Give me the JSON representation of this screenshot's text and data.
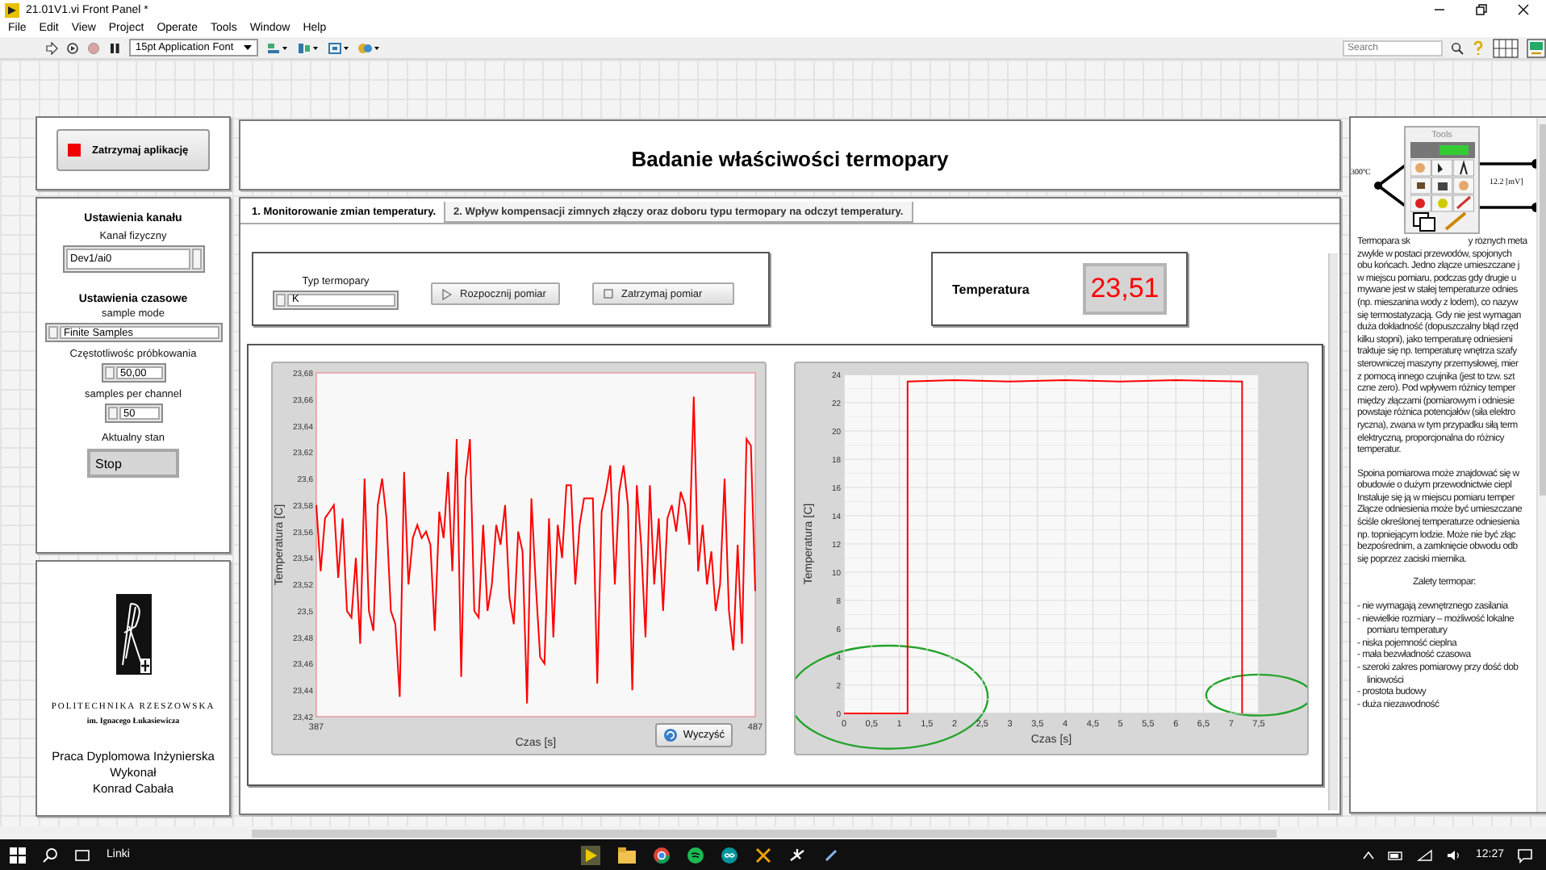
{
  "window": {
    "title": "21.01V1.vi Front Panel *"
  },
  "menu": [
    "File",
    "Edit",
    "View",
    "Project",
    "Operate",
    "Tools",
    "Window",
    "Help"
  ],
  "toolbar": {
    "font": "15pt Application Font",
    "search": {
      "placeholder": "Search"
    }
  },
  "stop_app_button": {
    "label": "Zatrzymaj aplikację"
  },
  "channel_settings": {
    "title": "Ustawienia kanału",
    "physical_channel": {
      "label": "Kanał fizyczny",
      "value": "Dev1/ai0"
    }
  },
  "timing_settings": {
    "title": "Ustawienia czasowe",
    "sample_mode": {
      "label": "sample mode",
      "value": "Finite Samples"
    },
    "sampling_rate": {
      "label": "Częstotliwośc próbkowania",
      "value": "50,00"
    },
    "samples_per_channel": {
      "label": "samples per channel",
      "value": "50"
    },
    "status": {
      "label": "Aktualny stan",
      "value": "Stop"
    }
  },
  "credits": {
    "university": "POLITECHNIKA RZESZOWSKA",
    "patron": "im. Ignacego Łukasiewicza",
    "lines": [
      "Praca Dyplomowa Inżynierska",
      "Wykonał",
      "Konrad Cabała"
    ]
  },
  "header": {
    "title": "Badanie właściwości termopary"
  },
  "tabs": [
    {
      "label": "1. Monitorowanie zmian temperatury.",
      "selected": true
    },
    {
      "label": "2. Wpływ kompensacji zimnych złączy oraz doboru typu termopary na odczyt temperatury.",
      "selected": false
    }
  ],
  "measurement": {
    "thermocouple_type": {
      "label": "Typ termopary",
      "value": "K"
    },
    "buttons": [
      {
        "label": "Rozpocznij pomiar",
        "kind": "play"
      },
      {
        "label": "Zatrzymaj pomiar",
        "kind": "stop"
      }
    ]
  },
  "temperature": {
    "label": "Temperatura",
    "value": "23,51"
  },
  "charts": [
    {
      "clear_button": "Wyczyść",
      "chart_data": {
        "type": "line",
        "xlabel": "Czas [s]",
        "ylabel": "Temperatura [C]",
        "xlim": [
          387,
          487
        ],
        "ylim": [
          23.42,
          23.68
        ],
        "grid": false,
        "x": [
          387,
          388,
          389,
          390,
          391,
          392,
          393,
          394,
          395,
          396,
          397,
          398,
          399,
          400,
          401,
          402,
          403,
          404,
          405,
          406,
          407,
          408,
          409,
          410,
          411,
          412,
          413,
          414,
          415,
          416,
          417,
          418,
          419,
          420,
          421,
          422,
          423,
          424,
          425,
          426,
          427,
          428,
          429,
          430,
          431,
          432,
          433,
          434,
          435,
          436,
          437,
          438,
          439,
          440,
          441,
          442,
          443,
          444,
          445,
          446,
          447,
          448,
          449,
          450,
          451,
          452,
          453,
          454,
          455,
          456,
          457,
          458,
          459,
          460,
          461,
          462,
          463,
          464,
          465,
          466,
          467,
          468,
          469,
          470,
          471,
          472,
          473,
          474,
          475,
          476,
          477,
          478,
          479,
          480,
          481,
          482,
          483,
          484,
          485,
          486,
          487
        ],
        "xticks": [
          {
            "value": 387,
            "label": "387"
          },
          {
            "value": 487,
            "label": "487"
          }
        ],
        "yticks": [
          {
            "value": 23.42,
            "label": "23,42"
          },
          {
            "value": 23.44,
            "label": "23,44"
          },
          {
            "value": 23.46,
            "label": "23,46"
          },
          {
            "value": 23.48,
            "label": "23,48"
          },
          {
            "value": 23.5,
            "label": "23,5"
          },
          {
            "value": 23.52,
            "label": "23,52"
          },
          {
            "value": 23.54,
            "label": "23,54"
          },
          {
            "value": 23.56,
            "label": "23,56"
          },
          {
            "value": 23.58,
            "label": "23,58"
          },
          {
            "value": 23.6,
            "label": "23,6"
          },
          {
            "value": 23.62,
            "label": "23,62"
          },
          {
            "value": 23.64,
            "label": "23,64"
          },
          {
            "value": 23.66,
            "label": "23,66"
          },
          {
            "value": 23.68,
            "label": "23,68"
          }
        ],
        "series": [
          {
            "color": "#ff0000",
            "values": [
              23.58,
              23.53,
              23.57,
              23.575,
              23.58,
              23.525,
              23.57,
              23.5,
              23.495,
              23.54,
              23.475,
              23.6,
              23.5,
              23.485,
              23.58,
              23.6,
              23.57,
              23.5,
              23.49,
              23.435,
              23.605,
              23.52,
              23.555,
              23.565,
              23.555,
              23.56,
              23.55,
              23.485,
              23.575,
              23.555,
              23.605,
              23.53,
              23.63,
              23.45,
              23.6,
              23.63,
              23.5,
              23.495,
              23.565,
              23.5,
              23.52,
              23.565,
              23.55,
              23.58,
              23.51,
              23.49,
              23.56,
              23.545,
              23.43,
              23.585,
              23.52,
              23.465,
              23.46,
              23.57,
              23.48,
              23.565,
              23.54,
              23.595,
              23.595,
              23.52,
              23.565,
              23.585,
              23.585,
              23.585,
              23.445,
              23.575,
              23.59,
              23.61,
              23.52,
              23.59,
              23.61,
              23.58,
              23.44,
              23.595,
              23.55,
              23.48,
              23.595,
              23.52,
              23.57,
              23.5,
              23.57,
              23.58,
              23.56,
              23.59,
              23.58,
              23.55,
              23.662,
              23.53,
              23.565,
              23.52,
              23.545,
              23.5,
              23.52,
              23.6,
              23.5,
              23.47,
              23.55,
              23.475,
              23.63,
              23.625,
              23.515
            ]
          }
        ]
      }
    },
    {
      "chart_data": {
        "type": "line",
        "xlabel": "Czas [s]",
        "ylabel": "Temperatura [C]",
        "xlim": [
          0,
          7.5
        ],
        "ylim": [
          0,
          24
        ],
        "grid": true,
        "x": [
          0,
          1.15,
          1.15,
          2,
          3,
          4,
          5,
          6,
          7.2,
          7.2
        ],
        "xticks": [
          {
            "value": 0,
            "label": "0"
          },
          {
            "value": 0.5,
            "label": "0,5"
          },
          {
            "value": 1,
            "label": "1"
          },
          {
            "value": 1.5,
            "label": "1,5"
          },
          {
            "value": 2,
            "label": "2"
          },
          {
            "value": 2.5,
            "label": "2,5"
          },
          {
            "value": 3,
            "label": "3"
          },
          {
            "value": 3.5,
            "label": "3,5"
          },
          {
            "value": 4,
            "label": "4"
          },
          {
            "value": 4.5,
            "label": "4,5"
          },
          {
            "value": 5,
            "label": "5"
          },
          {
            "value": 5.5,
            "label": "5,5"
          },
          {
            "value": 6,
            "label": "6"
          },
          {
            "value": 6.5,
            "label": "6,5"
          },
          {
            "value": 7,
            "label": "7"
          },
          {
            "value": 7.5,
            "label": "7,5"
          }
        ],
        "yticks": [
          0,
          2,
          4,
          6,
          8,
          10,
          12,
          14,
          16,
          18,
          20,
          22,
          24
        ],
        "series": [
          {
            "color": "#ff0000",
            "values": [
              0,
              0,
              23.5,
              23.6,
              23.5,
              23.6,
              23.5,
              23.6,
              23.5,
              0
            ]
          }
        ]
      }
    }
  ],
  "info_panel": {
    "tools_palette": {
      "title": "Tools"
    },
    "diagram": {
      "temperature": "300ºC",
      "voltage": "12.2 [mV]"
    },
    "first_line_parts": [
      "Termopara sk",
      "y różnych meta"
    ],
    "paragraphs": [
      [
        "zwykle w postaci przewodów, spojonych",
        "obu końcach. Jedno złącze umieszczane j",
        "w miejscu pomiaru, podczas gdy drugie u",
        "mywane jest w stałej temperaturze odnies",
        "(np. mieszanina wody z lodem), co nazyw",
        "się termostatyzacją. Gdy nie jest wymagan",
        "duża dokładność (dopuszczalny błąd rzęd",
        "kilku stopni), jako temperaturę odniesieni",
        "traktuje się np. temperaturę wnętrza szafy",
        "sterowniczej maszyny przemysłowej, mier",
        "z pomocą innego czujnika (jest to tzw. szt",
        "czne zero). Pod wpływem różnicy temper",
        "między złączami (pomiarowym i odniesie",
        "powstaje różnica potencjałów (siła elektro",
        "ryczna), zwana w tym przypadku siłą term",
        "elektryczną, proporcjonalna do różnicy",
        "temperatur."
      ],
      [
        "Spoina pomiarowa może znajdować się w",
        "obudowie o dużym przewodnictwie ciepl",
        "Instaluje się ją w miejscu pomiaru temper",
        "Złącze odniesienia może być umieszczane",
        "ściśle określonej temperaturze odniesienia",
        "np. topniejącym lodzie. Może nie być złąc",
        "bezpośrednim, a zamknięcie obwodu odb",
        "się poprzez zaciski miernika."
      ]
    ],
    "advantages_title": "Zalety termopar:",
    "advantages": [
      {
        "text": "- nie wymagają zewnętrznego zasilania"
      },
      {
        "text": "- niewielkie rozmiary – możliwość lokalne",
        "continuation": "pomiaru temperatury"
      },
      {
        "text": "- niska pojemność cieplna"
      },
      {
        "text": "- mała bezwładność czasowa"
      },
      {
        "text": "- szeroki zakres pomiarowy przy dość dob",
        "continuation": "liniowości"
      },
      {
        "text": "- prostota budowy"
      },
      {
        "text": "- duża niezawodność"
      }
    ]
  },
  "taskbar": {
    "search_label": "Linki",
    "clock": "12:27"
  }
}
